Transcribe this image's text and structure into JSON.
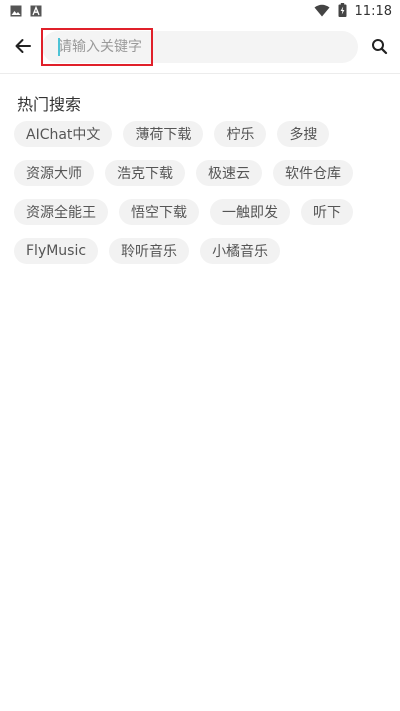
{
  "status_bar": {
    "time": "11:18",
    "left_icons": [
      "image-icon",
      "font-icon"
    ],
    "right_icons": [
      "wifi-icon",
      "battery-charging-icon"
    ]
  },
  "search": {
    "placeholder": "请输入关键字",
    "value": "",
    "back_icon": "arrow-left-icon",
    "search_icon": "search-icon"
  },
  "hot_search": {
    "title": "热门搜索",
    "tags": [
      "AIChat中文",
      "薄荷下载",
      "柠乐",
      "多搜",
      "资源大师",
      "浩克下载",
      "极速云",
      "软件仓库",
      "资源全能王",
      "悟空下载",
      "一触即发",
      "听下",
      "FlyMusic",
      "聆听音乐",
      "小橘音乐"
    ]
  },
  "colors": {
    "highlight": "#e0202a",
    "tag_bg": "#f2f2f2",
    "input_bg": "#f4f4f4"
  }
}
